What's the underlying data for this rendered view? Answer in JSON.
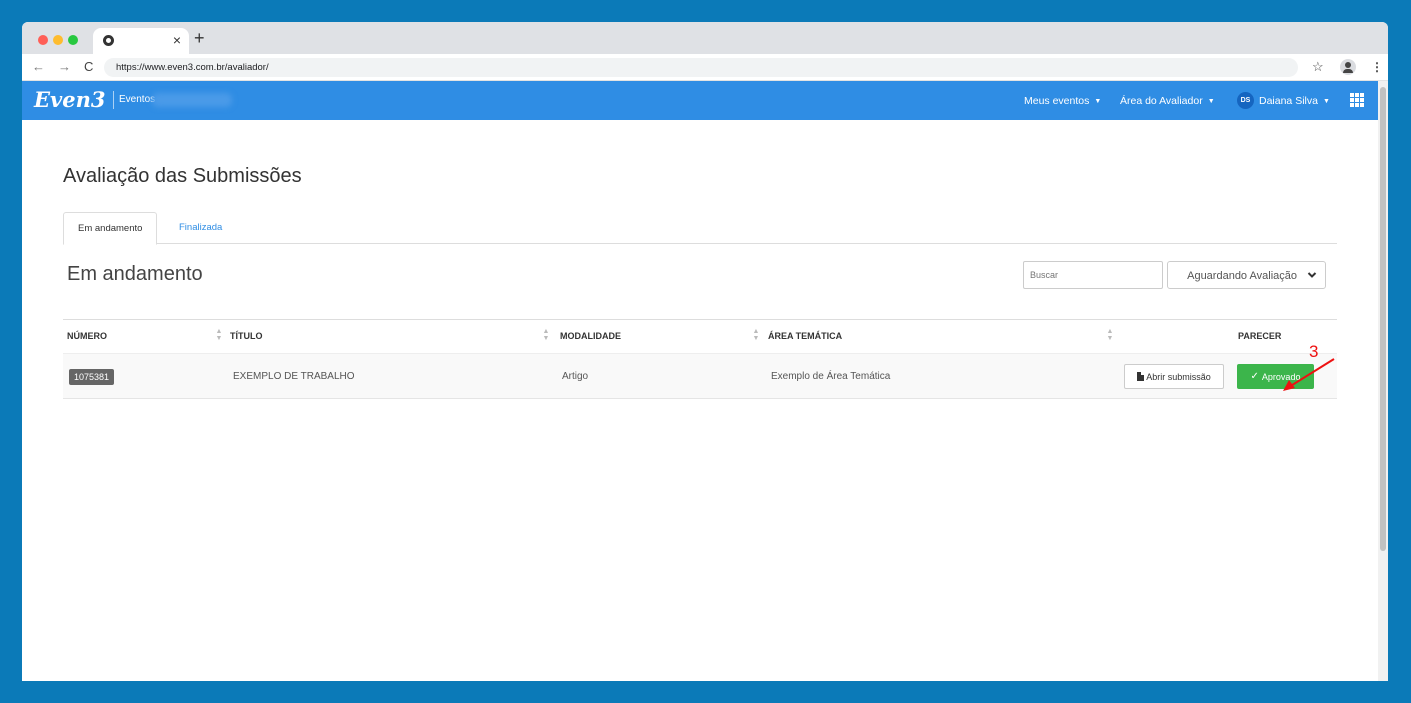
{
  "browser": {
    "url": "https://www.even3.com.br/avaliador/",
    "tab_close": "×",
    "new_tab": "+",
    "icons": {
      "back": "arrow-left",
      "forward": "arrow-right",
      "reload": "reload",
      "bookmark": "star",
      "profile": "person",
      "menu": "kebab"
    }
  },
  "navbar": {
    "logo": "Even3",
    "brand_sub": "Eventos",
    "links": {
      "meus_eventos": "Meus eventos",
      "area_avaliador": "Área do Avaliador",
      "user_name": "Daiana Silva"
    },
    "avatar_initials": "DS",
    "color": "#2f8de4"
  },
  "page": {
    "title": "Avaliação das Submissões",
    "tabs": [
      {
        "label": "Em andamento",
        "active": true
      },
      {
        "label": "Finalizada",
        "active": false
      }
    ],
    "section_title": "Em andamento",
    "search_placeholder": "Buscar",
    "status_filter": "Aguardando Avaliação"
  },
  "table": {
    "columns": [
      "NÚMERO",
      "TÍTULO",
      "MODALIDADE",
      "ÁREA TEMÁTICA",
      "",
      "PARECER"
    ],
    "rows": [
      {
        "numero": "1075381",
        "titulo": "EXEMPLO DE TRABALHO",
        "modalidade": "Artigo",
        "area": "Exemplo de Área Temática",
        "open_label": "Abrir submissão",
        "parecer_label": "Aprovado"
      }
    ]
  },
  "annotation": {
    "number": "3",
    "color": "#e11111"
  },
  "colors": {
    "background": "#0b7ab8",
    "approved": "#3cb54b"
  }
}
